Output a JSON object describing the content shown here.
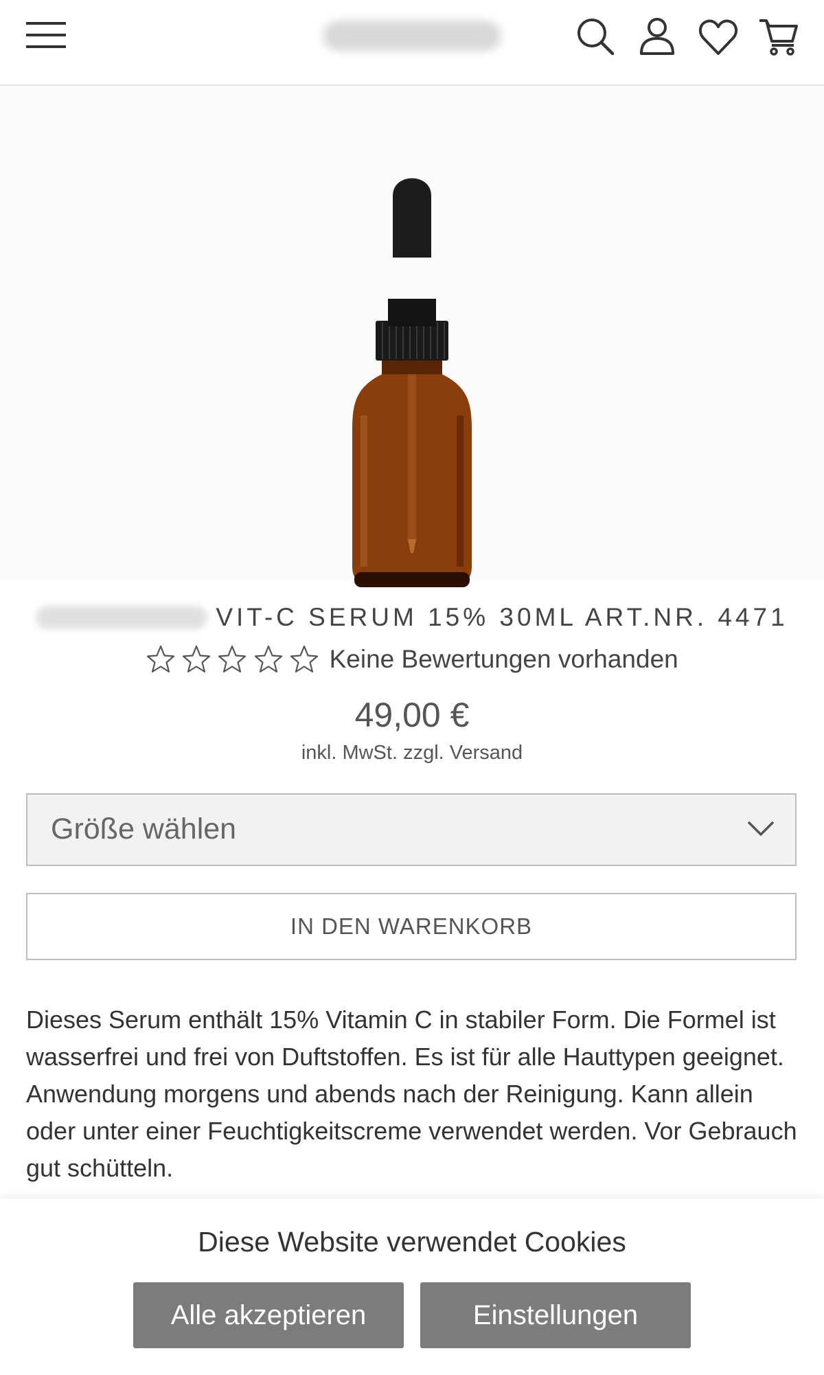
{
  "header": {
    "icons": [
      "menu-icon",
      "search-icon",
      "user-icon",
      "heart-icon",
      "cart-icon"
    ]
  },
  "product": {
    "title": "VIT-C SERUM 15% 30ML ART.NR. 4471",
    "rating_text": "Keine Bewertungen vorhanden",
    "rating_stars": 0,
    "rating_max": 5,
    "price": "49,00 €",
    "tax_note": "inkl. MwSt. zzgl. Versand",
    "size_select_label": "Größe wählen",
    "add_to_cart_label": "IN DEN WARENKORB",
    "description": "Dieses Serum enthält 15% Vitamin C in stabiler Form. Die Formel ist wasserfrei und frei von Duftstoffen. Es ist für alle Hauttypen geeignet. Anwendung morgens und abends nach der Reinigung. Kann allein oder unter einer Feuchtigkeitscreme verwendet werden. Vor Gebrauch gut schütteln."
  },
  "cookie_banner": {
    "text": "Diese Website verwendet Cookies",
    "accept_label": "Alle akzeptieren",
    "settings_label": "Einstellungen"
  },
  "colors": {
    "button_gray": "#7c7c7c",
    "border_gray": "#bdbdbd",
    "select_bg": "#f2f2f2",
    "bottle_amber": "#8a3e0c"
  }
}
